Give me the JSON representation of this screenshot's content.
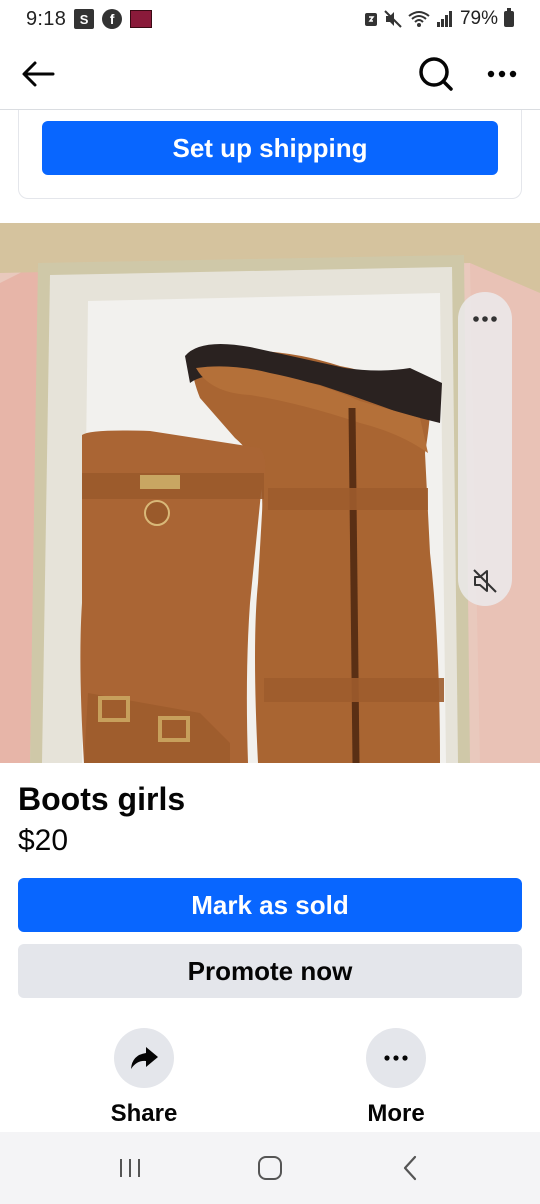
{
  "status_bar": {
    "time": "9:18",
    "s_badge": "S",
    "battery_percent": "79%"
  },
  "nav": {
    "back_icon": "arrow-left-icon",
    "search_icon": "search-icon",
    "more_icon": "more-dots-icon"
  },
  "shipping": {
    "button_label": "Set up shipping"
  },
  "photo": {
    "subject": "boots",
    "more_icon": "more-dots-icon",
    "mute_icon": "speaker-muted-icon"
  },
  "listing": {
    "title": "Boots girls",
    "price": "$20"
  },
  "buttons": {
    "mark_sold": "Mark as sold",
    "promote": "Promote now"
  },
  "actions": {
    "share_label": "Share",
    "more_label": "More"
  },
  "colors": {
    "primary": "#0866ff",
    "secondary_bg": "#e4e6eb",
    "text": "#050505"
  }
}
